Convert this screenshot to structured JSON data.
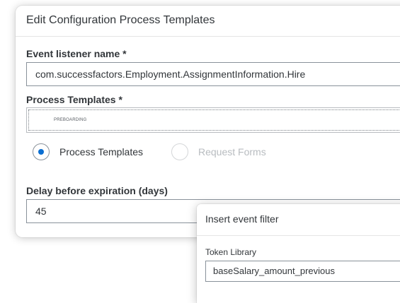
{
  "dialog": {
    "title": "Edit Configuration Process Templates",
    "event_listener": {
      "label": "Event listener name *",
      "value": "com.successfactors.Employment.AssignmentInformation.Hire"
    },
    "process_templates": {
      "label": "Process Templates *",
      "token": "PREBOARDING"
    },
    "radio_options": [
      {
        "label": "Process Templates",
        "selected": true
      },
      {
        "label": "Request Forms",
        "selected": false
      }
    ],
    "delay": {
      "label": "Delay before expiration (days)",
      "value": "45"
    }
  },
  "popover": {
    "title": "Insert event filter",
    "token_library_label": "Token Library",
    "token_library_value": "baseSalary_amount_previous"
  },
  "colors": {
    "accent": "#0a6ed1",
    "text": "#32363a",
    "disabled_text": "#b8bcc0",
    "border": "#89919a"
  }
}
